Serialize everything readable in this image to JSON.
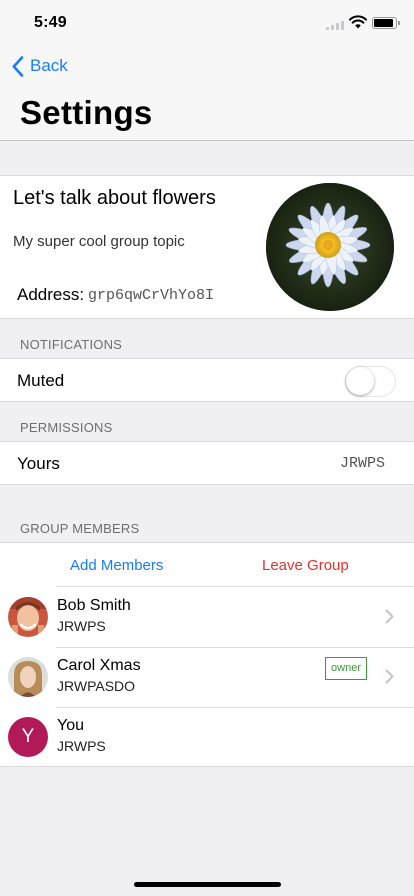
{
  "status_bar": {
    "time": "5:49"
  },
  "nav": {
    "back_label": "Back",
    "title": "Settings"
  },
  "topic": {
    "name": "Let's talk about flowers",
    "description": "My super cool group topic",
    "address_label": "Address:",
    "address_value": "grp6qwCrVhYo8I"
  },
  "notifications": {
    "header": "NOTIFICATIONS",
    "muted_label": "Muted",
    "muted": false
  },
  "permissions": {
    "header": "PERMISSIONS",
    "yours_label": "Yours",
    "yours_value": "JRWPS"
  },
  "group_members": {
    "header": "GROUP MEMBERS",
    "add_label": "Add Members",
    "leave_label": "Leave Group",
    "members": [
      {
        "name": "Bob Smith",
        "permissions": "JRWPS",
        "badge": ""
      },
      {
        "name": "Carol Xmas",
        "permissions": "JRWPASDO",
        "badge": "owner"
      },
      {
        "name": "You",
        "permissions": "JRWPS",
        "badge": "",
        "initial": "Y"
      }
    ]
  },
  "colors": {
    "accent": "#1a7cf2",
    "danger": "#e8322b",
    "owner_badge": "#3c9a3c",
    "you_avatar": "#b11a56"
  }
}
